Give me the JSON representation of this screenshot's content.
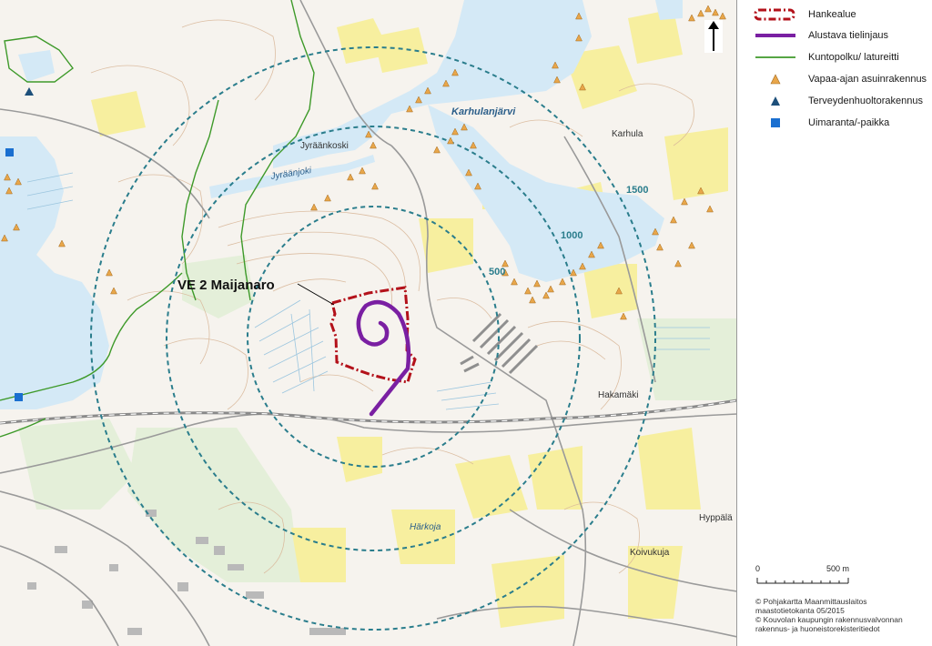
{
  "legend": {
    "items": [
      {
        "label": "Hankealue",
        "symbol": "dashdot-red-polygon",
        "color": "#b3111a"
      },
      {
        "label": "Alustava tielinjaus",
        "symbol": "purple-line",
        "color": "#7a1fa2"
      },
      {
        "label": "Kuntopolku/ latureitti",
        "symbol": "green-line",
        "color": "#3e9a2a"
      },
      {
        "label": "Vapaa-ajan asuinrakennus",
        "symbol": "triangle-icon",
        "color": "#e8a64a"
      },
      {
        "label": "Terveydenhuoltorakennus",
        "symbol": "triangle-icon",
        "color": "#1d4f7a"
      },
      {
        "label": "Uimaranta/-paikka",
        "symbol": "square-icon",
        "color": "#1a6fd0"
      }
    ],
    "north_arrow": "north-arrow-icon"
  },
  "scale_bar": {
    "start_label": "0",
    "end_label": "500 m"
  },
  "credits": [
    "© Pohjakartta Maanmittauslaitos",
    "maastotietokanta 05/2015",
    "© Kouvolan kaupungin rakennusvalvonnan",
    "rakennus- ja huoneistorekisteritiedot"
  ],
  "map": {
    "project_label": "VE 2 Maijanaro",
    "buffer_labels": [
      "500",
      "1000",
      "1500"
    ],
    "place_names": [
      {
        "text": "Karhulanjärvi",
        "style": "water"
      },
      {
        "text": "Jyräänkoski",
        "style": "place"
      },
      {
        "text": "Jyräänjoki",
        "style": "water"
      },
      {
        "text": "Karhula",
        "style": "place"
      },
      {
        "text": "Hakamäki",
        "style": "place"
      },
      {
        "text": "Härkoja",
        "style": "water"
      },
      {
        "text": "Hyppälä",
        "style": "place"
      },
      {
        "text": "Koivukuja",
        "style": "place"
      }
    ],
    "colors": {
      "background": "#f6f3ee",
      "water": "#d4e9f6",
      "field": "#f7ef9f",
      "forest": "#e4efd9",
      "contour": "#d9b89a",
      "buffer": "#2a7d8c",
      "road": "#9a9a9a"
    }
  }
}
